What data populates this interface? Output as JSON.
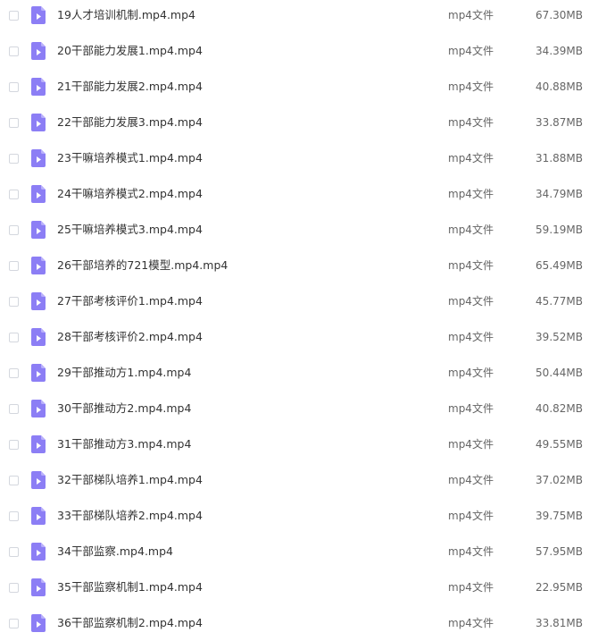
{
  "file_list": {
    "items": [
      {
        "name": "19人才培训机制.mp4.mp4",
        "type": "mp4文件",
        "size": "67.30MB",
        "icon": "video-file-icon"
      },
      {
        "name": "20干部能力发展1.mp4.mp4",
        "type": "mp4文件",
        "size": "34.39MB",
        "icon": "video-file-icon"
      },
      {
        "name": "21干部能力发展2.mp4.mp4",
        "type": "mp4文件",
        "size": "40.88MB",
        "icon": "video-file-icon"
      },
      {
        "name": "22干部能力发展3.mp4.mp4",
        "type": "mp4文件",
        "size": "33.87MB",
        "icon": "video-file-icon"
      },
      {
        "name": "23干嘛培养模式1.mp4.mp4",
        "type": "mp4文件",
        "size": "31.88MB",
        "icon": "video-file-icon"
      },
      {
        "name": "24干嘛培养模式2.mp4.mp4",
        "type": "mp4文件",
        "size": "34.79MB",
        "icon": "video-file-icon"
      },
      {
        "name": "25干嘛培养模式3.mp4.mp4",
        "type": "mp4文件",
        "size": "59.19MB",
        "icon": "video-file-icon"
      },
      {
        "name": "26干部培养的721模型.mp4.mp4",
        "type": "mp4文件",
        "size": "65.49MB",
        "icon": "video-file-icon"
      },
      {
        "name": "27干部考核评价1.mp4.mp4",
        "type": "mp4文件",
        "size": "45.77MB",
        "icon": "video-file-icon"
      },
      {
        "name": "28干部考核评价2.mp4.mp4",
        "type": "mp4文件",
        "size": "39.52MB",
        "icon": "video-file-icon"
      },
      {
        "name": "29干部推动方1.mp4.mp4",
        "type": "mp4文件",
        "size": "50.44MB",
        "icon": "video-file-icon"
      },
      {
        "name": "30干部推动方2.mp4.mp4",
        "type": "mp4文件",
        "size": "40.82MB",
        "icon": "video-file-icon"
      },
      {
        "name": "31干部推动方3.mp4.mp4",
        "type": "mp4文件",
        "size": "49.55MB",
        "icon": "video-file-icon"
      },
      {
        "name": "32干部梯队培养1.mp4.mp4",
        "type": "mp4文件",
        "size": "37.02MB",
        "icon": "video-file-icon"
      },
      {
        "name": "33干部梯队培养2.mp4.mp4",
        "type": "mp4文件",
        "size": "39.75MB",
        "icon": "video-file-icon"
      },
      {
        "name": "34干部监察.mp4.mp4",
        "type": "mp4文件",
        "size": "57.95MB",
        "icon": "video-file-icon"
      },
      {
        "name": "35干部监察机制1.mp4.mp4",
        "type": "mp4文件",
        "size": "22.95MB",
        "icon": "video-file-icon"
      },
      {
        "name": "36干部监察机制2.mp4.mp4",
        "type": "mp4文件",
        "size": "33.81MB",
        "icon": "video-file-icon"
      }
    ]
  },
  "colors": {
    "icon_fill": "#8c7ef5",
    "icon_fold": "#b9b0fb",
    "icon_play": "#ffffff"
  }
}
